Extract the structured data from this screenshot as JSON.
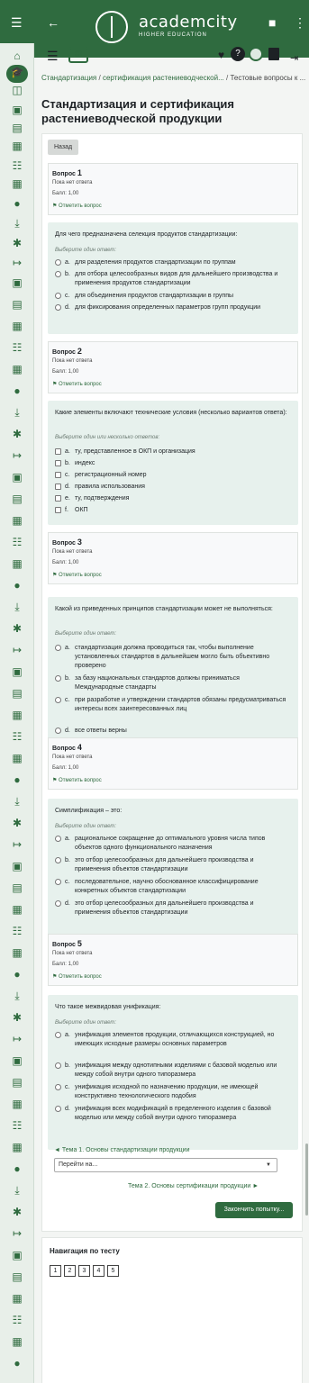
{
  "header": {
    "logo_name": "academcity",
    "logo_sub": "HIGHER EDUCATION",
    "icons": [
      "menu-icon",
      "back-icon",
      "bookmark-icon",
      "more-icon"
    ]
  },
  "sidebar": {
    "icons": [
      "home-icon",
      "graduation-cap-icon",
      "notification-icon",
      "book-icon",
      "chat-icon",
      "calendar-icon",
      "list-icon",
      "calendar-icon",
      "user-icon",
      "download-icon",
      "gear-icon",
      "exit-icon"
    ],
    "active_index": 1
  },
  "toolbar": {
    "icons": [
      "hamburger-icon",
      "cart-icon",
      "heart-icon",
      "help-icon",
      "avatar-icon",
      "book-icon",
      "logout-icon"
    ]
  },
  "breadcrumb": {
    "items": [
      "Стандартизация",
      "сертификация растениеводческой...",
      "Тестовые вопросы к ..."
    ],
    "sep": "/"
  },
  "page_title": "Стандартизация и сертификация растениеводческой продукции",
  "nav_button": "Назад",
  "questions": [
    {
      "number_label": "Вопрос",
      "number": "1",
      "status": "Пока нет ответа",
      "mark": "Балл: 1,00",
      "flag": "Отметить вопрос",
      "text": "Для чего предназначена селекция продуктов стандартизации:",
      "prompt": "Выберите один ответ:",
      "multi": false,
      "options": [
        {
          "letter": "a.",
          "text": "для разделения продуктов стандартизации по группам"
        },
        {
          "letter": "b.",
          "text": "для отбора целесообразных видов для дальнейшего производства и применения продуктов стандартизации"
        },
        {
          "letter": "c.",
          "text": "для объединения продуктов стандартизации в группы"
        },
        {
          "letter": "d.",
          "text": "для фиксирования определенных параметров групп продукции"
        }
      ]
    },
    {
      "number_label": "Вопрос",
      "number": "2",
      "status": "Пока нет ответа",
      "mark": "Балл: 1,00",
      "flag": "Отметить вопрос",
      "text": "Какие элементы включают технические условия (несколько вариантов ответа):",
      "prompt": "Выберите один или несколько ответов:",
      "multi": true,
      "options": [
        {
          "letter": "a.",
          "text": "ту, представленное в ОКП и организация"
        },
        {
          "letter": "b.",
          "text": "индекс"
        },
        {
          "letter": "c.",
          "text": "регистрационный номер"
        },
        {
          "letter": "d.",
          "text": "правила использования"
        },
        {
          "letter": "e.",
          "text": "ту, подтверждения"
        },
        {
          "letter": "f.",
          "text": "ОКП"
        }
      ]
    },
    {
      "number_label": "Вопрос",
      "number": "3",
      "status": "Пока нет ответа",
      "mark": "Балл: 1,00",
      "flag": "Отметить вопрос",
      "text": "Какой из приведенных принципов стандартизации может не выполняться:",
      "prompt": "Выберите один ответ:",
      "multi": false,
      "options": [
        {
          "letter": "a.",
          "text": "стандартизация должна проводиться так, чтобы выполнение установленных стандартов в дальнейшем могло быть объективно проверено"
        },
        {
          "letter": "b.",
          "text": "за базу национальных стандартов должны приниматься Международные стандарты"
        },
        {
          "letter": "c.",
          "text": "при разработке и утверждении стандартов обязаны предусматриваться интересы всех заинтересованных лиц"
        },
        {
          "letter": "d.",
          "text": "все ответы верны"
        }
      ]
    },
    {
      "number_label": "Вопрос",
      "number": "4",
      "status": "Пока нет ответа",
      "mark": "Балл: 1,00",
      "flag": "Отметить вопрос",
      "text": "Симплификация – это:",
      "prompt": "Выберите один ответ:",
      "multi": false,
      "options": [
        {
          "letter": "a.",
          "text": "рациональное сокращение до оптимального уровня числа типов объектов одного функционального назначения"
        },
        {
          "letter": "b.",
          "text": "это отбор целесообразных для дальнейшего производства и применения объектов стандартизации"
        },
        {
          "letter": "c.",
          "text": "последовательное, научно обоснованное классифицирование конкретных объектов стандартизации"
        },
        {
          "letter": "d.",
          "text": "это отбор целесообразных для дальнейшего производства и применения объектов стандартизации"
        }
      ]
    },
    {
      "number_label": "Вопрос",
      "number": "5",
      "status": "Пока нет ответа",
      "mark": "Балл: 1,00",
      "flag": "Отметить вопрос",
      "text": "Что такое межвидовая унификация:",
      "prompt": "Выберите один ответ:",
      "multi": false,
      "options": [
        {
          "letter": "a.",
          "text": "унификация элементов продукции, отличающихся конструкцией, но имеющих исходные размеры основных параметров"
        },
        {
          "letter": "b.",
          "text": "унификация между однотипными изделиями с базовой моделью или между собой внутри одного типоразмера"
        },
        {
          "letter": "c.",
          "text": "унификация исходной по назначению продукции, не имеющей конструктивно технологического подобия"
        },
        {
          "letter": "d.",
          "text": "унификация всех модификаций в пределенного изделия с базовой моделью или между собой внутри одного типоразмера"
        }
      ]
    }
  ],
  "finish_button": "Закончить попытку...",
  "prev_link": "◄ Тема 1. Основы стандартизации продукции",
  "jump_select": "Перейти на...",
  "next_link": "Тема 2. Основы сертификации продукции ►",
  "quiz_nav": {
    "title": "Навигация по тесту",
    "numbers": [
      "1",
      "2",
      "3",
      "4",
      "5"
    ]
  }
}
